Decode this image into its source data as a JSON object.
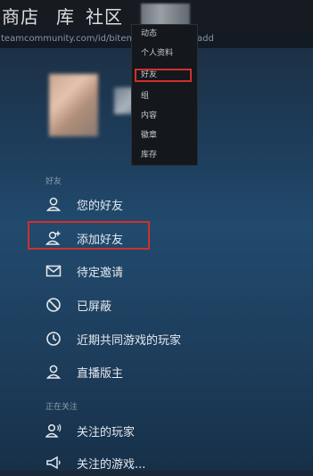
{
  "topnav": {
    "store": "商店",
    "library": "库",
    "community": "社区"
  },
  "url": {
    "left": "teamcommunity.com/id/bitemeua",
    "right": "add"
  },
  "dropdown": {
    "items": [
      "动态",
      "个人资料",
      "好友",
      "组",
      "内容",
      "徽章",
      "库存"
    ],
    "highlight_color": "#d0302a"
  },
  "sidebar": {
    "friends_section": "好友",
    "friends_items": [
      {
        "label": "您的好友",
        "icon": "person-icon"
      },
      {
        "label": "添加好友",
        "icon": "add-person-icon"
      },
      {
        "label": "待定邀请",
        "icon": "envelope-icon"
      },
      {
        "label": "已屏蔽",
        "icon": "blocked-icon"
      },
      {
        "label": "近期共同游戏的玩家",
        "icon": "clock-icon"
      },
      {
        "label": "直播版主",
        "icon": "person-icon"
      }
    ],
    "following_section": "正在关注",
    "following_items": [
      {
        "label": "关注的玩家",
        "icon": "person-sound-icon"
      },
      {
        "label": "关注的游戏...",
        "icon": "megaphone-icon"
      }
    ]
  }
}
